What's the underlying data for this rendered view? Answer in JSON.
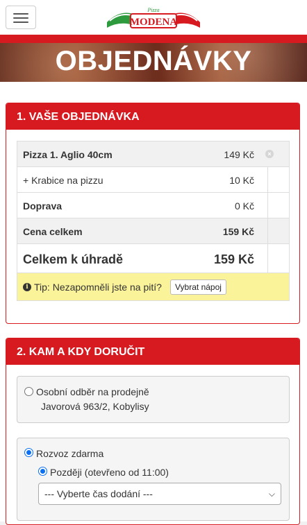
{
  "header": {
    "menu_icon": "hamburger-icon",
    "logo_text": "MODENA",
    "logo_small": "Pizza"
  },
  "hero": {
    "title": "OBJEDNÁVKY"
  },
  "order": {
    "title": "1. VAŠE OBJEDNÁVKA",
    "items": [
      {
        "name": "Pizza 1. Aglio 40cm",
        "price": "149 Kč"
      },
      {
        "name": "+ Krabice na pizzu",
        "price": "10 Kč"
      },
      {
        "name": "Doprava",
        "price": "0 Kč"
      },
      {
        "name": "Cena celkem",
        "price": "159 Kč"
      }
    ],
    "total_label": "Celkem k úhradě",
    "total_price": "159 Kč",
    "tip_text": "Tip: Nezapomněli jste na pití?",
    "tip_button": "Vybrat nápoj"
  },
  "delivery": {
    "title": "2. KAM A KDY DORUČIT",
    "pickup_label": "Osobní odběr na prodejně",
    "pickup_address": "Javorová 963/2, Kobylisy",
    "delivery_label": "Rozvoz zdarma",
    "later_label": "Později (otevřeno od 11:00)",
    "time_select": "--- Vyberte čas dodání ---"
  },
  "colors": {
    "brand_red": "#d71920",
    "tip_yellow": "#fbf39a"
  }
}
